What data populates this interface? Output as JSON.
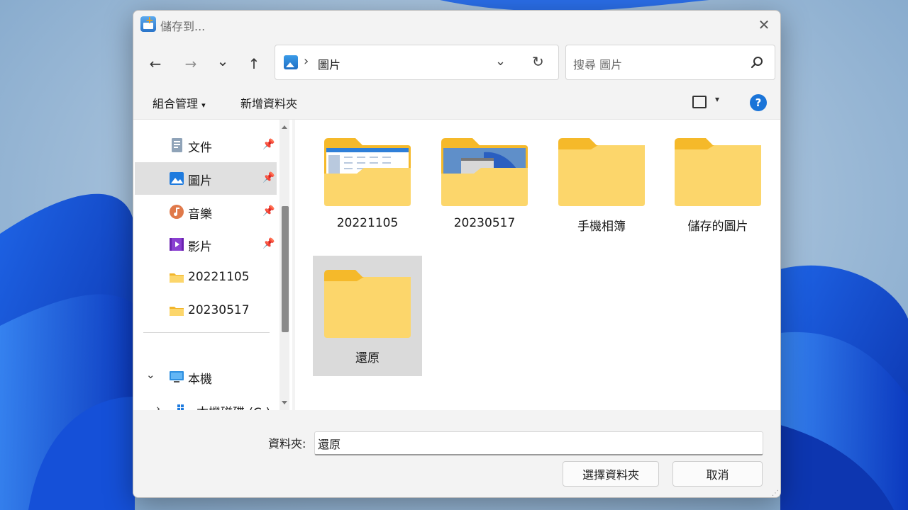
{
  "window": {
    "title": "儲存到...",
    "close_label": "✕"
  },
  "nav": {
    "back": "←",
    "forward": "→",
    "recent": "⌄",
    "up": "↑"
  },
  "address": {
    "separator": "›",
    "path": "圖片",
    "dropdown": "⌄",
    "refresh": "↻"
  },
  "search": {
    "placeholder": "搜尋 圖片"
  },
  "toolbar": {
    "organize": "組合管理",
    "new_folder": "新增資料夾",
    "view_dropdown": "▾",
    "help": "?"
  },
  "sidebar": {
    "quick_access": [
      {
        "label": "文件",
        "icon": "document-icon",
        "pinned": true
      },
      {
        "label": "圖片",
        "icon": "pictures-icon",
        "pinned": true,
        "selected": true
      },
      {
        "label": "音樂",
        "icon": "music-icon",
        "pinned": true
      },
      {
        "label": "影片",
        "icon": "videos-icon",
        "pinned": true
      },
      {
        "label": "20221105",
        "icon": "folder-icon",
        "pinned": false
      },
      {
        "label": "20230517",
        "icon": "folder-icon",
        "pinned": false
      }
    ],
    "this_pc": "本機",
    "drive": "本機磁碟 (C:)",
    "pin_glyph": "📌"
  },
  "folders": [
    {
      "name": "20221105",
      "preview": "screenshot-table"
    },
    {
      "name": "20230517",
      "preview": "screenshot-desktop"
    },
    {
      "name": "手機相簿",
      "preview": "none"
    },
    {
      "name": "儲存的圖片",
      "preview": "none"
    },
    {
      "name": "還原",
      "preview": "none",
      "selected": true
    }
  ],
  "footer": {
    "folder_label": "資料夾:",
    "folder_value": "還原",
    "select_button": "選擇資料夾",
    "cancel_button": "取消"
  },
  "colors": {
    "accent": "#1a74d8",
    "folder_front": "#fcd66b",
    "folder_back": "#f5b92a",
    "selection": "#dadada"
  }
}
